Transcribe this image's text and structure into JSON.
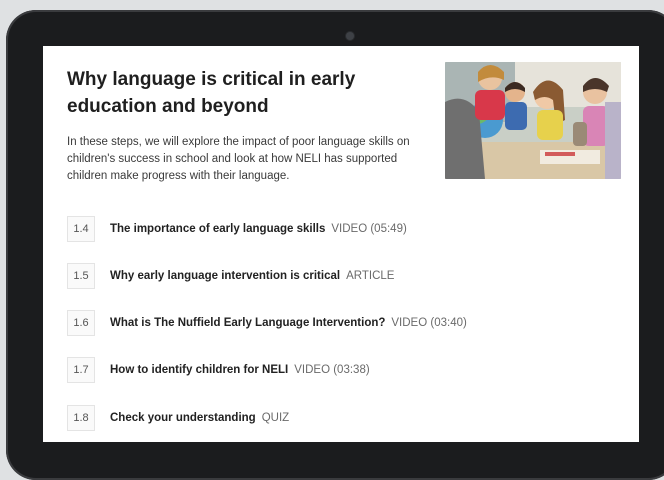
{
  "course": {
    "title": "Why language is critical in early education and beyond",
    "intro": "In these steps, we will explore the impact of poor language skills on children's success in school and look at how NELI has supported children make progress with their language."
  },
  "photo": {
    "icon": "children-classroom-photo"
  },
  "steps": [
    {
      "number": "1.4",
      "label": "The importance of early language skills",
      "type": "VIDEO (05:49)"
    },
    {
      "number": "1.5",
      "label": "Why early language intervention is critical",
      "type": "ARTICLE"
    },
    {
      "number": "1.6",
      "label": "What is The Nuffield Early Language Intervention?",
      "type": "VIDEO (03:40)"
    },
    {
      "number": "1.7",
      "label": "How to identify children for NELI",
      "type": "VIDEO (03:38)"
    },
    {
      "number": "1.8",
      "label": "Check your understanding",
      "type": "QUIZ"
    }
  ],
  "colors": {
    "bezel": "#1b1c1e",
    "screen": "#ffffff",
    "text": "#1f1f1f",
    "muted": "#6a6a6a"
  }
}
